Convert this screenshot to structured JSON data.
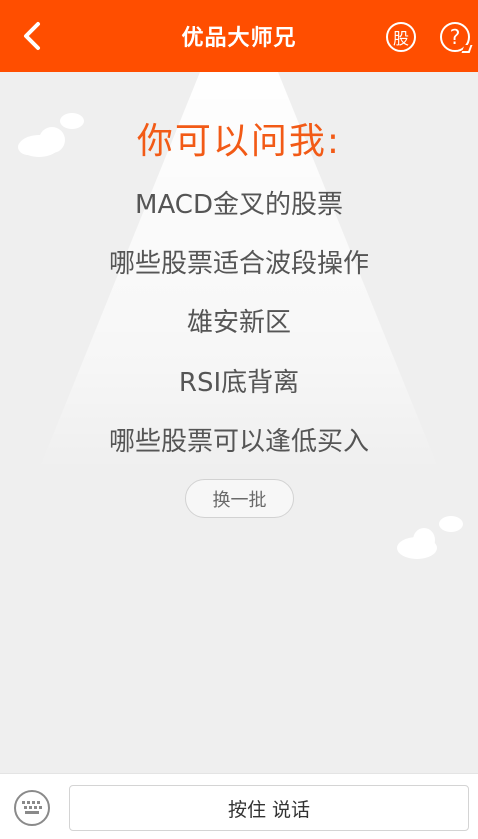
{
  "header": {
    "title": "优品大师兄",
    "stock_label": "股",
    "help_label": "?"
  },
  "prompt": {
    "title": "你可以问我:"
  },
  "suggestions": [
    "MACD金叉的股票",
    "哪些股票适合波段操作",
    "雄安新区",
    "RSI底背离",
    "哪些股票可以逢低买入"
  ],
  "refresh_label": "换一批",
  "bottom": {
    "voice_label": "按住 说话"
  },
  "colors": {
    "header_bg": "#ff4e00",
    "title_accent": "#f25a16",
    "page_bg": "#efefef"
  },
  "icons": {
    "back": "chevron-left-icon",
    "stock": "stock-icon",
    "help": "help-icon",
    "keyboard": "keyboard-icon"
  }
}
